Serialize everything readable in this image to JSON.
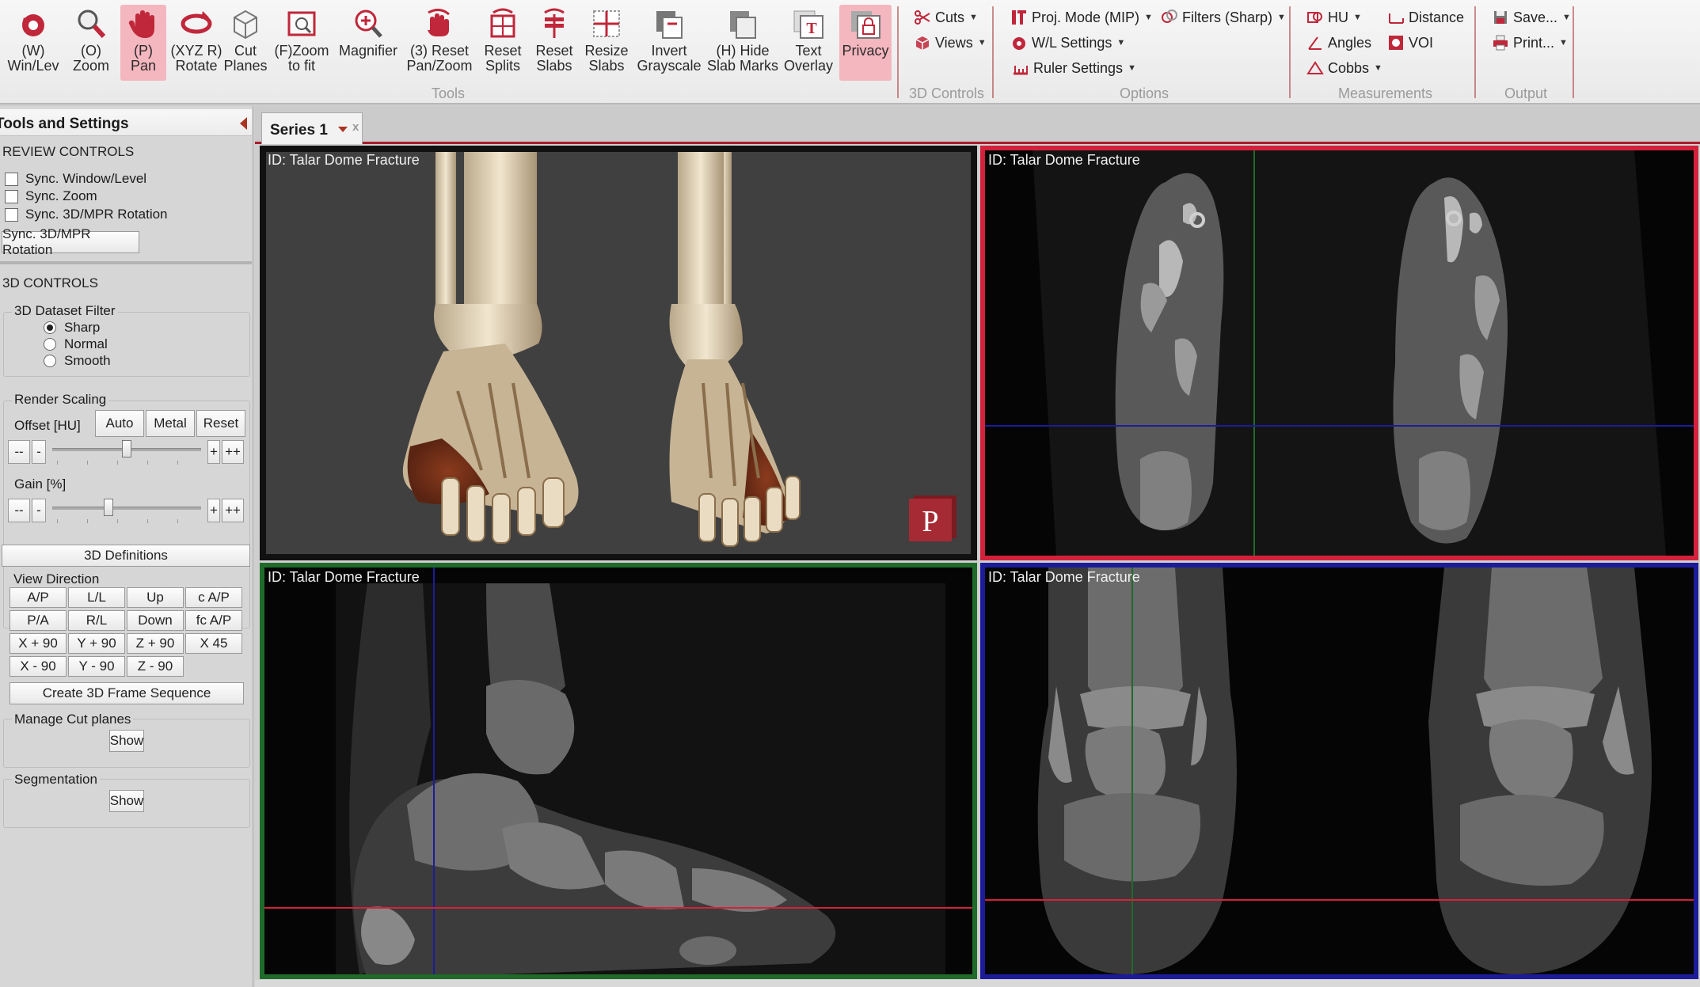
{
  "ribbon": {
    "tools": [
      {
        "label": "(W)\nWin/Lev",
        "icon": "window-level-icon"
      },
      {
        "label": "(O)\nZoom",
        "icon": "zoom-icon"
      },
      {
        "label": "(P)\nPan",
        "icon": "pan-hand-icon"
      },
      {
        "label": "(XYZ R)\nRotate",
        "icon": "rotate-icon"
      },
      {
        "label": "Cut\nPlanes",
        "icon": "cut-planes-icon"
      },
      {
        "label": "(F)Zoom\nto fit",
        "icon": "zoom-to-fit-icon"
      },
      {
        "label": "Magnifier",
        "icon": "magnifier-icon"
      },
      {
        "label": "(3) Reset\nPan/Zoom",
        "icon": "reset-pan-zoom-icon"
      },
      {
        "label": "Reset\nSplits",
        "icon": "reset-splits-icon"
      },
      {
        "label": "Reset\nSlabs",
        "icon": "reset-slabs-icon"
      },
      {
        "label": "Resize\nSlabs",
        "icon": "resize-slabs-icon"
      },
      {
        "label": "Invert\nGrayscale",
        "icon": "invert-grayscale-icon"
      },
      {
        "label": "(H) Hide\nSlab Marks",
        "icon": "hide-slab-marks-icon"
      },
      {
        "label": "Text\nOverlay",
        "icon": "text-overlay-icon"
      },
      {
        "label": "Privacy",
        "icon": "privacy-icon"
      }
    ],
    "groups": {
      "tools": "Tools",
      "controls_3d": "3D Controls",
      "options": "Options",
      "measurements": "Measurements",
      "output": "Output"
    },
    "controls_3d": {
      "cuts": "Cuts",
      "views": "Views"
    },
    "options": {
      "proj_mode": "Proj. Mode (MIP)",
      "filters": "Filters (Sharp)",
      "wl_settings": "W/L Settings",
      "ruler_settings": "Ruler Settings"
    },
    "measurements": {
      "hu": "HU",
      "distance": "Distance",
      "angles": "Angles",
      "voi": "VOI",
      "cobbs": "Cobbs"
    },
    "output": {
      "save": "Save...",
      "print": "Print..."
    },
    "accent": "#c0273a"
  },
  "panel": {
    "title": "Tools and Settings",
    "review": {
      "heading": "REVIEW CONTROLS",
      "sync_wl": "Sync. Window/Level",
      "sync_zoom": "Sync. Zoom",
      "sync_rotation": "Sync. 3D/MPR Rotation",
      "sync_button": "Sync. 3D/MPR Rotation"
    },
    "controls_3d": {
      "heading": "3D CONTROLS",
      "filter_caption": "3D Dataset Filter",
      "filters": [
        "Sharp",
        "Normal",
        "Smooth"
      ],
      "selected_filter": "Sharp",
      "render_caption": "Render Scaling",
      "offset_label": "Offset [HU]",
      "auto": "Auto",
      "metal": "Metal",
      "reset": "Reset",
      "gain_label": "Gain [%]",
      "minus2": "--",
      "minus1": "-",
      "plus1": "+",
      "plus2": "++",
      "offset_level": 0.5,
      "gain_level": 0.38
    },
    "definitions_button": "3D Definitions",
    "view_direction": {
      "caption": "View Direction",
      "rows": [
        [
          "A/P",
          "L/L",
          "Up",
          "c A/P"
        ],
        [
          "P/A",
          "R/L",
          "Down",
          "fc A/P"
        ],
        [
          "X + 90",
          "Y + 90",
          "Z + 90",
          "X 45"
        ],
        [
          "X - 90",
          "Y - 90",
          "Z - 90"
        ]
      ],
      "create_sequence": "Create 3D Frame Sequence"
    },
    "cut_planes": {
      "caption": "Manage Cut planes",
      "show": "Show"
    },
    "segmentation": {
      "caption": "Segmentation",
      "show": "Show"
    }
  },
  "series_tab": {
    "label": "Series 1",
    "close": "x"
  },
  "viewports": [
    {
      "id_label": "ID: Talar Dome Fracture",
      "border": "#111111"
    },
    {
      "id_label": "ID: Talar Dome Fracture",
      "border": "#d4213b"
    },
    {
      "id_label": "ID: Talar Dome Fracture",
      "border": "#1f6b2a"
    },
    {
      "id_label": "ID: Talar Dome Fracture",
      "border": "#1c1c9a"
    }
  ],
  "watermark_letter": "P"
}
